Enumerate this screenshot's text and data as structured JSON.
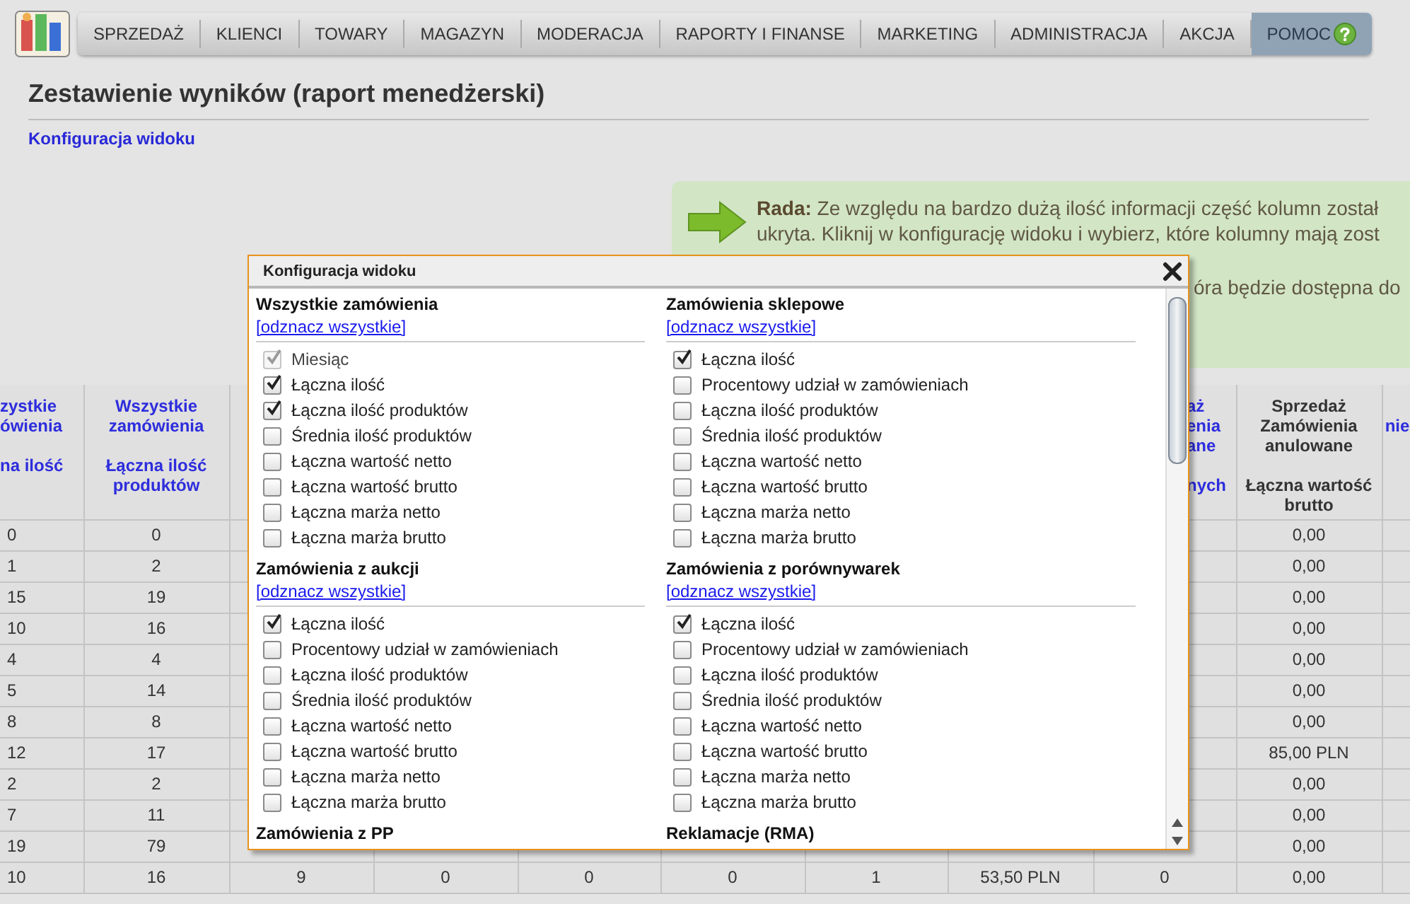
{
  "nav": {
    "items": [
      {
        "label": "SPRZEDAŻ",
        "selected": false,
        "kind": "menu"
      },
      {
        "label": "KLIENCI",
        "selected": false,
        "kind": "menu"
      },
      {
        "label": "TOWARY",
        "selected": false,
        "kind": "menu"
      },
      {
        "label": "MAGAZYN",
        "selected": false,
        "kind": "menu"
      },
      {
        "label": "MODERACJA",
        "selected": false,
        "kind": "menu"
      },
      {
        "label": "RAPORTY I FINANSE",
        "selected": false,
        "kind": "menu"
      },
      {
        "label": "MARKETING",
        "selected": false,
        "kind": "menu"
      },
      {
        "label": "ADMINISTRACJA",
        "selected": false,
        "kind": "menu"
      },
      {
        "label": "AKCJA",
        "selected": false,
        "kind": "menu"
      },
      {
        "label": "POMOC",
        "selected": true,
        "kind": "help"
      }
    ]
  },
  "page_title": "Zestawienie wyników (raport menedżerski)",
  "config_link": "Konfiguracja widoku",
  "tip": {
    "lines": [
      "**Rada:** Ze względu na bardzo dużą ilość informacji część kolumn został",
      "ukryta. Kliknij w konfigurację widoku i wybierz, które kolumny mają zost"
    ],
    "covered_line": "óra będzie dostępna do"
  },
  "table": {
    "columns": [
      {
        "title": [
          "zystkie",
          "ówienia"
        ],
        "subtitle": [
          "na ilość"
        ],
        "link": true
      },
      {
        "title": [
          "Wszystkie",
          "zamówienia"
        ],
        "subtitle": [
          "Łączna ilość",
          "produktów"
        ],
        "link": true
      },
      {},
      {},
      {},
      {},
      {},
      {},
      {
        "title": [
          "aż",
          "enia",
          "ane"
        ],
        "subtitle": [
          "nych"
        ],
        "link": true
      },
      {
        "title": [
          "Sprzedaż",
          "Zamówienia",
          "anulowane"
        ],
        "subtitle": [
          "Łączna wartość",
          "brutto"
        ],
        "link": false
      },
      {
        "subtitle": [
          "nie"
        ],
        "link": true
      }
    ],
    "rows": [
      {
        "column_1": "0",
        "column_2": "0",
        "column_10": "0,00"
      },
      {
        "column_1": "1",
        "column_2": "2",
        "column_10": "0,00"
      },
      {
        "column_1": "15",
        "column_2": "19",
        "column_10": "0,00"
      },
      {
        "column_1": "10",
        "column_2": "16",
        "column_10": "0,00"
      },
      {
        "column_1": "4",
        "column_2": "4",
        "column_10": "0,00"
      },
      {
        "column_1": "5",
        "column_2": "14",
        "column_10": "0,00"
      },
      {
        "column_1": "8",
        "column_2": "8",
        "column_10": "0,00"
      },
      {
        "column_1": "12",
        "column_2": "17",
        "column_10": "85,00 PLN"
      },
      {
        "column_1": "2",
        "column_2": "2",
        "column_10": "0,00"
      },
      {
        "column_1": "7",
        "column_2": "11",
        "column_10": "0,00"
      },
      {
        "column_1": "19",
        "column_2": "79",
        "column_10": "0,00"
      },
      {
        "column_1": "10",
        "column_2": "16",
        "column_3": "9",
        "column_4": "0",
        "column_5": "0",
        "column_6": "0",
        "column_7": "1",
        "column_8": "53,50 PLN",
        "column_9": "0",
        "column_10": "0,00"
      }
    ]
  },
  "dialog": {
    "title": "Konfiguracja widoku",
    "sections": [
      {
        "title": "Wszystkie zamówienia",
        "link": "[odznacz wszystkie]",
        "items": [
          {
            "label": "Miesiąc",
            "checked": true,
            "disabled": true
          },
          {
            "label": "Łączna ilość",
            "checked": true,
            "disabled": false
          },
          {
            "label": "Łączna ilość produktów",
            "checked": true,
            "disabled": false
          },
          {
            "label": "Średnia ilość produktów",
            "checked": false,
            "disabled": false
          },
          {
            "label": "Łączna wartość netto",
            "checked": false,
            "disabled": false
          },
          {
            "label": "Łączna wartość brutto",
            "checked": false,
            "disabled": false
          },
          {
            "label": "Łączna marża netto",
            "checked": false,
            "disabled": false
          },
          {
            "label": "Łączna marża brutto",
            "checked": false,
            "disabled": false
          }
        ]
      },
      {
        "title": "Zamówienia sklepowe",
        "link": "[odznacz wszystkie]",
        "items": [
          {
            "label": "Łączna ilość",
            "checked": true,
            "disabled": false
          },
          {
            "label": "Procentowy udział w zamówieniach",
            "checked": false,
            "disabled": false
          },
          {
            "label": "Łączna ilość produktów",
            "checked": false,
            "disabled": false
          },
          {
            "label": "Średnia ilość produktów",
            "checked": false,
            "disabled": false
          },
          {
            "label": "Łączna wartość netto",
            "checked": false,
            "disabled": false
          },
          {
            "label": "Łączna wartość brutto",
            "checked": false,
            "disabled": false
          },
          {
            "label": "Łączna marża netto",
            "checked": false,
            "disabled": false
          },
          {
            "label": "Łączna marża brutto",
            "checked": false,
            "disabled": false
          }
        ]
      },
      {
        "title": "Zamówienia z aukcji",
        "link": "[odznacz wszystkie]",
        "items": [
          {
            "label": "Łączna ilość",
            "checked": true,
            "disabled": false
          },
          {
            "label": "Procentowy udział w zamówieniach",
            "checked": false,
            "disabled": false
          },
          {
            "label": "Łączna ilość produktów",
            "checked": false,
            "disabled": false
          },
          {
            "label": "Średnia ilość produktów",
            "checked": false,
            "disabled": false
          },
          {
            "label": "Łączna wartość netto",
            "checked": false,
            "disabled": false
          },
          {
            "label": "Łączna wartość brutto",
            "checked": false,
            "disabled": false
          },
          {
            "label": "Łączna marża netto",
            "checked": false,
            "disabled": false
          },
          {
            "label": "Łączna marża brutto",
            "checked": false,
            "disabled": false
          }
        ]
      },
      {
        "title": "Zamówienia z porównywarek",
        "link": "[odznacz wszystkie]",
        "items": [
          {
            "label": "Łączna ilość",
            "checked": true,
            "disabled": false
          },
          {
            "label": "Procentowy udział w zamówieniach",
            "checked": false,
            "disabled": false
          },
          {
            "label": "Łączna ilość produktów",
            "checked": false,
            "disabled": false
          },
          {
            "label": "Średnia ilość produktów",
            "checked": false,
            "disabled": false
          },
          {
            "label": "Łączna wartość netto",
            "checked": false,
            "disabled": false
          },
          {
            "label": "Łączna wartość brutto",
            "checked": false,
            "disabled": false
          },
          {
            "label": "Łączna marża netto",
            "checked": false,
            "disabled": false
          },
          {
            "label": "Łączna marża brutto",
            "checked": false,
            "disabled": false
          }
        ]
      },
      {
        "title": "Zamówienia z PP"
      },
      {
        "title": "Reklamacje (RMA)"
      }
    ]
  }
}
